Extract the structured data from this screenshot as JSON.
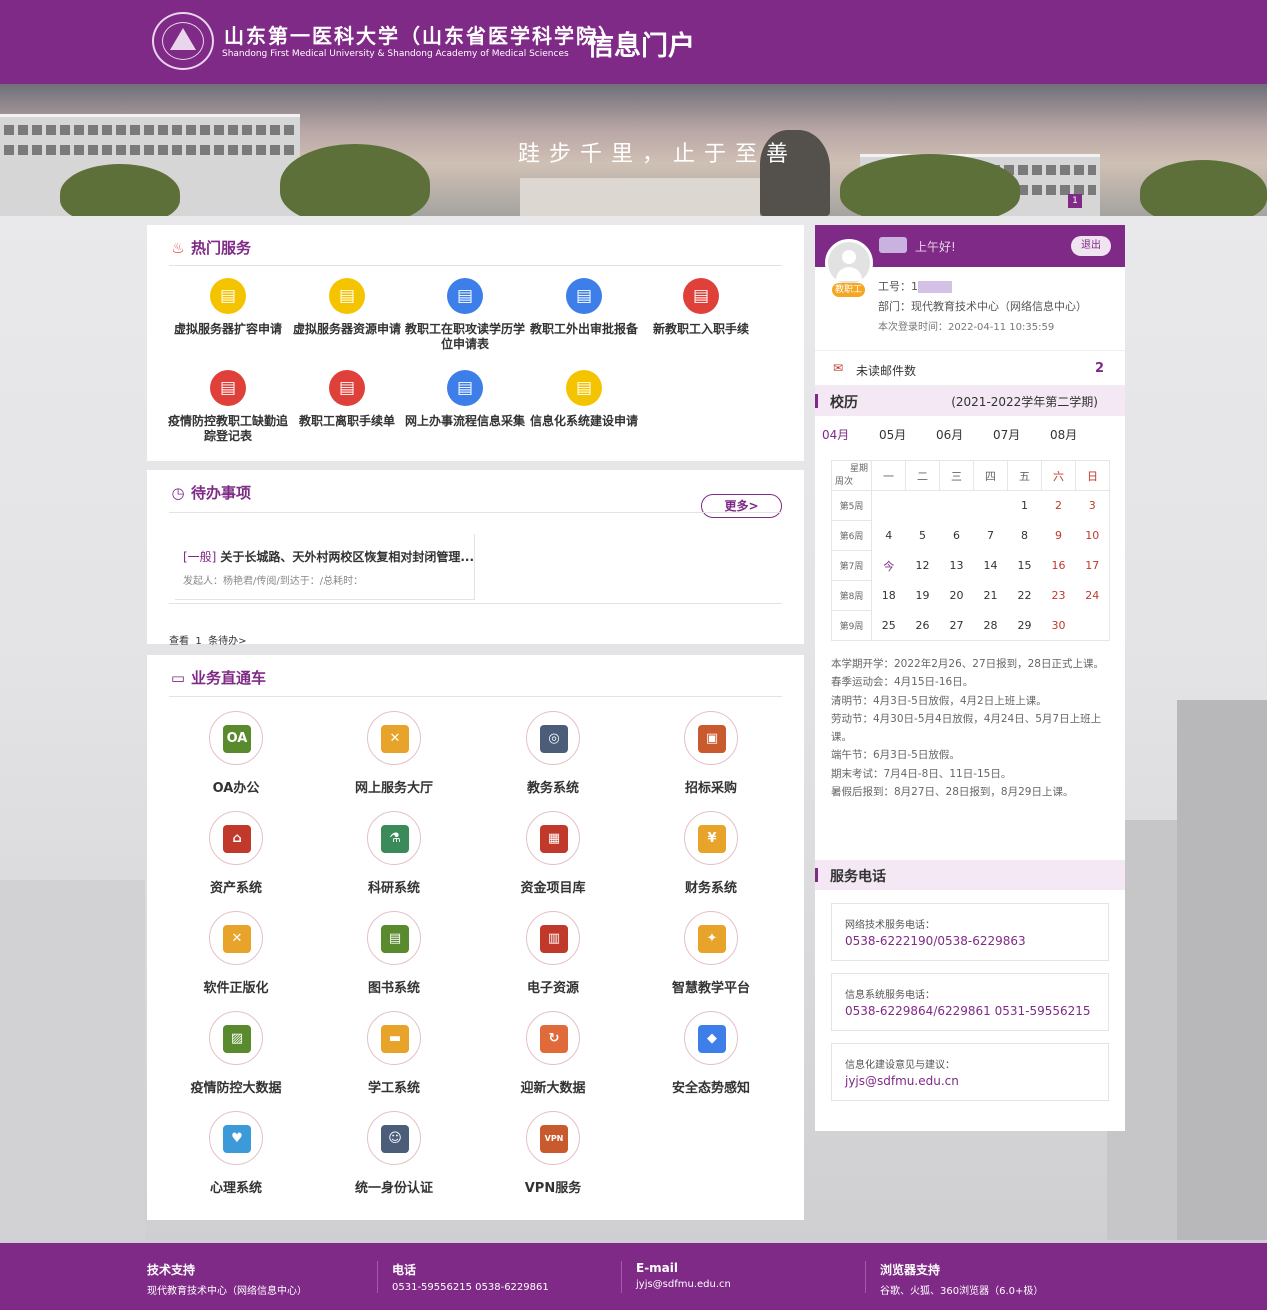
{
  "header": {
    "university_cn": "山东第一医科大学（山东省医学科学院）",
    "university_en": "Shandong First Medical University & Shandong Academy of Medical Sciences",
    "portal_title": "信息门户",
    "brand_color": "#7f2a86"
  },
  "banner": {
    "slogan": "跬步千里，止于至善",
    "page_indicator": "1"
  },
  "hot_services": {
    "title": "热门服务",
    "icon": "flame-icon",
    "items": [
      {
        "label": "虚拟服务器扩容申请",
        "icon": "document-icon",
        "color": "#f5c400"
      },
      {
        "label": "虚拟服务器资源申请",
        "icon": "document-icon",
        "color": "#f5c400"
      },
      {
        "label": "教职工在职攻读学历学位申请表",
        "icon": "form-icon",
        "color": "#3d7ee8"
      },
      {
        "label": "教职工外出审批报备",
        "icon": "clipboard-icon",
        "color": "#3d7ee8"
      },
      {
        "label": "新教职工入职手续",
        "icon": "stamp-icon",
        "color": "#e0403a"
      },
      {
        "label": "疫情防控教职工缺勤追踪登记表",
        "icon": "edit-icon",
        "color": "#e0403a"
      },
      {
        "label": "教职工离职手续单",
        "icon": "form-icon",
        "color": "#e0403a"
      },
      {
        "label": "网上办事流程信息采集",
        "icon": "flow-icon",
        "color": "#3d7ee8"
      },
      {
        "label": "信息化系统建设申请",
        "icon": "document-icon",
        "color": "#f5c400"
      }
    ]
  },
  "todo": {
    "title": "待办事项",
    "icon": "clock-icon",
    "more_label": "更多>",
    "items": [
      {
        "tag": "[一般]",
        "title": "关于长城路、天外村两校区恢复相对封闭管理...",
        "meta": "发起人：杨艳君/传阅/到达于：/总耗时："
      }
    ],
    "footer_prefix": "查看",
    "footer_count": "1",
    "footer_suffix": "条待办>"
  },
  "business": {
    "title": "业务直通车",
    "icon": "monitor-icon",
    "items": [
      {
        "label": "OA办公",
        "icon": "oa-icon",
        "glyph": "OA",
        "color": "#5a8a2e"
      },
      {
        "label": "网上服务大厅",
        "icon": "tools-icon",
        "glyph": "✕",
        "color": "#e8a32a"
      },
      {
        "label": "教务系统",
        "icon": "glasses-icon",
        "glyph": "◎",
        "color": "#4c5d7a"
      },
      {
        "label": "招标采购",
        "icon": "box-icon",
        "glyph": "▣",
        "color": "#c95a2e"
      },
      {
        "label": "资产系统",
        "icon": "house-icon",
        "glyph": "⌂",
        "color": "#c0392b"
      },
      {
        "label": "科研系统",
        "icon": "microscope-icon",
        "glyph": "⚗",
        "color": "#3a8a5a"
      },
      {
        "label": "资金项目库",
        "icon": "abacus-icon",
        "glyph": "▦",
        "color": "#c0392b"
      },
      {
        "label": "财务系统",
        "icon": "money-bag-icon",
        "glyph": "¥",
        "color": "#e8a32a"
      },
      {
        "label": "软件正版化",
        "icon": "tools-icon",
        "glyph": "✕",
        "color": "#e8a32a"
      },
      {
        "label": "图书系统",
        "icon": "book-icon",
        "glyph": "▤",
        "color": "#5a8a2e"
      },
      {
        "label": "电子资源",
        "icon": "calculator-icon",
        "glyph": "▥",
        "color": "#c0392b"
      },
      {
        "label": "智慧教学平台",
        "icon": "bulb-icon",
        "glyph": "✦",
        "color": "#e8a32a"
      },
      {
        "label": "疫情防控大数据",
        "icon": "board-icon",
        "glyph": "▨",
        "color": "#5a8a2e"
      },
      {
        "label": "学工系统",
        "icon": "desk-icon",
        "glyph": "▬",
        "color": "#e8a32a"
      },
      {
        "label": "迎新大数据",
        "icon": "refresh-icon",
        "glyph": "↻",
        "color": "#e06a3a"
      },
      {
        "label": "安全态势感知",
        "icon": "shield-icon",
        "glyph": "◆",
        "color": "#3d7ee8"
      },
      {
        "label": "心理系统",
        "icon": "heart-icon",
        "glyph": "♥",
        "color": "#3d9ad8"
      },
      {
        "label": "统一身份认证",
        "icon": "graduate-icon",
        "glyph": "☺",
        "color": "#4c5d7a"
      },
      {
        "label": "VPN服务",
        "icon": "vpn-icon",
        "glyph": "VPN",
        "color": "#c95a2e"
      }
    ]
  },
  "user": {
    "greeting": "上午好!",
    "logout_label": "退出",
    "badge": "教职工",
    "id_label": "工号：",
    "id_value": "1",
    "dept_label": "部门：",
    "dept_value": "现代教育技术中心（网络信息中心）",
    "login_label": "本次登录时间：",
    "login_time": "2022-04-11 10:35:59",
    "mail_label": "未读邮件数",
    "mail_count": "2"
  },
  "calendar": {
    "title": "校历",
    "term": "(2021-2022学年第二学期)",
    "months": [
      "04月",
      "05月",
      "06月",
      "07月",
      "08月"
    ],
    "active_month": "04月",
    "header_week_label": "星期",
    "header_row_label": "周次",
    "weekday_headers": [
      "一",
      "二",
      "三",
      "四",
      "五",
      "六",
      "日"
    ],
    "weeks": [
      {
        "label": "第5周",
        "days": [
          "",
          "",
          "",
          "",
          "1",
          "2",
          "3"
        ]
      },
      {
        "label": "第6周",
        "days": [
          "4",
          "5",
          "6",
          "7",
          "8",
          "9",
          "10"
        ]
      },
      {
        "label": "第7周",
        "days": [
          "今",
          "12",
          "13",
          "14",
          "15",
          "16",
          "17"
        ]
      },
      {
        "label": "第8周",
        "days": [
          "18",
          "19",
          "20",
          "21",
          "22",
          "23",
          "24"
        ]
      },
      {
        "label": "第9周",
        "days": [
          "25",
          "26",
          "27",
          "28",
          "29",
          "30",
          ""
        ]
      }
    ],
    "notes": [
      "本学期开学：2022年2月26、27日报到，28日正式上课。",
      "春季运动会：4月15日-16日。",
      "清明节：4月3日-5日放假，4月2日上班上课。",
      "劳动节：4月30日-5月4日放假，4月24日、5月7日上班上课。",
      "端午节：6月3日-5日放假。",
      "期末考试：7月4日-8日、11日-15日。",
      "暑假后报到：8月27日、28日报到，8月29日上课。"
    ]
  },
  "service_phone": {
    "title": "服务电话",
    "items": [
      {
        "label": "网络技术服务电话：",
        "value": "0538-6222190/0538-6229863"
      },
      {
        "label": "信息系统服务电话：",
        "value": "0538-6229864/6229861 0531-59556215"
      },
      {
        "label": "信息化建设意见与建议：",
        "value": "jyjs@sdfmu.edu.cn"
      }
    ]
  },
  "footer": {
    "columns": [
      {
        "heading": "技术支持",
        "value": "现代教育技术中心（网络信息中心）"
      },
      {
        "heading": "电话",
        "value": "0531-59556215 0538-6229861"
      },
      {
        "heading": "E-mail",
        "value": "jyjs@sdfmu.edu.cn"
      },
      {
        "heading": "浏览器支持",
        "value": "谷歌、火狐、360浏览器（6.0+极）"
      }
    ]
  }
}
